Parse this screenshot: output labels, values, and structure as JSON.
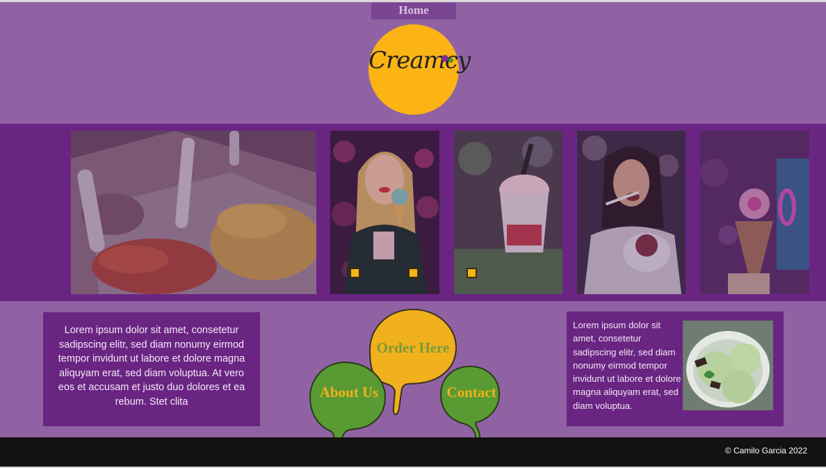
{
  "nav": {
    "home_label": "Home"
  },
  "logo": {
    "text": "Creamcy"
  },
  "gallery": {
    "photos": [
      {
        "name": "ice-cream-tubs-photo"
      },
      {
        "name": "woman-with-cone-photo"
      },
      {
        "name": "milkshake-cup-photo"
      },
      {
        "name": "woman-eating-sundae-photo"
      },
      {
        "name": "rose-cone-photo"
      }
    ]
  },
  "about_text": "Lorem ipsum dolor sit amet, consetetur sadipscing elitr, sed diam nonumy eirmod tempor invidunt ut labore et dolore magna aliquyam erat, sed diam voluptua. At vero eos et accusam et justo duo dolores et ea rebum. Stet clita",
  "buttons": {
    "order_label": "Order Here",
    "about_label": "About Us",
    "contact_label": "Contact"
  },
  "side_text": "Lorem ipsum dolor sit amet, consetetur sadipscing elitr, sed diam nonumy eirmod tempor invidunt ut labore et dolore magna aliquyam erat, sed diam voluptua.",
  "footer": {
    "copyright": "© Camilo Garcia 2022"
  },
  "colors": {
    "header_bg": "#9062a3",
    "gallery_bg": "#6a2583",
    "accent_yellow": "#fbb414",
    "accent_green": "#5a9a32",
    "footer_bg": "#121210"
  }
}
